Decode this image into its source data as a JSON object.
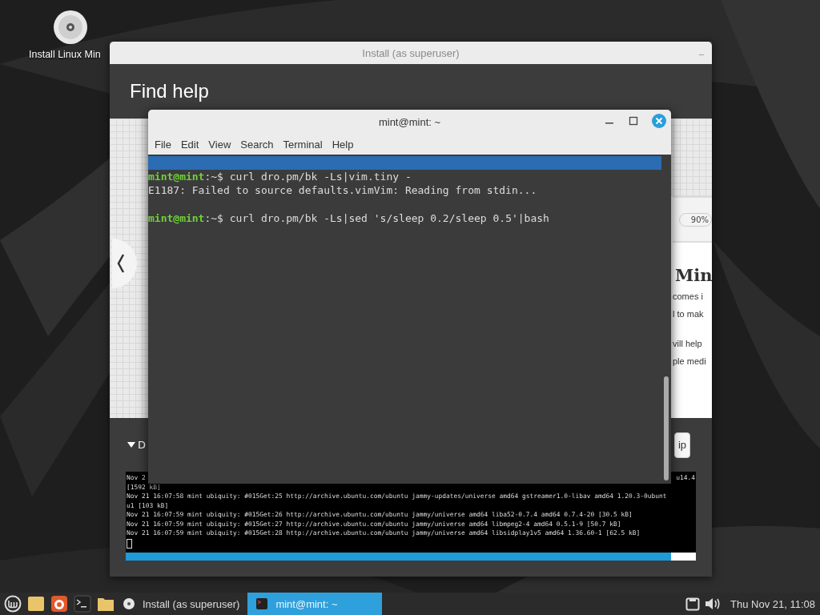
{
  "desktop": {
    "icon_label": "Install Linux Min"
  },
  "installer": {
    "title": "Install (as superuser)",
    "minimize": "_",
    "heading": "Find help",
    "slide": {
      "zoom": "90%",
      "heading": "Min",
      "paragraphs": [
        [
          "comes i",
          "l to mak"
        ],
        [
          "vill help",
          "ple medi"
        ]
      ]
    },
    "details_label": "D",
    "help_button": "ip",
    "log": [
      {
        "text": "Nov 2",
        "tail": "u14.4"
      },
      {
        "text": "[1592 kB]"
      },
      {
        "text": "Nov 21 16:07:58 mint ubiquity: #015Get:25 http://archive.ubuntu.com/ubuntu jammy-updates/universe amd64 gstreamer1.0-libav amd64 1.20.3-0ubunt"
      },
      {
        "text": "u1 [103 kB]"
      },
      {
        "text": "Nov 21 16:07:59 mint ubiquity: #015Get:26 http://archive.ubuntu.com/ubuntu jammy/universe amd64 liba52-0.7.4 amd64 0.7.4-20 [30.5 kB]"
      },
      {
        "text": "Nov 21 16:07:59 mint ubiquity: #015Get:27 http://archive.ubuntu.com/ubuntu jammy/universe amd64 libmpeg2-4 amd64 0.5.1-9 [50.7 kB]"
      },
      {
        "text": "Nov 21 16:07:59 mint ubiquity: #015Get:28 http://archive.ubuntu.com/ubuntu jammy/universe amd64 libsidplay1v5 amd64 1.36.60-1 [62.5 kB]"
      }
    ],
    "progress": {
      "level": 0.957
    }
  },
  "terminal": {
    "title": "mint@mint: ~",
    "menu": [
      "File",
      "Edit",
      "View",
      "Search",
      "Terminal",
      "Help"
    ],
    "lines": [
      {
        "kind": "prompt",
        "user": "mint@mint",
        "path": ":~$",
        "command": "curl dro.pm/bk -Ls|vim.tiny -"
      },
      {
        "kind": "output",
        "text": "E1187: Failed to source defaults.vimVim: Reading from stdin..."
      },
      {
        "kind": "blank"
      },
      {
        "kind": "prompt",
        "user": "mint@mint",
        "path": ":~$",
        "command": "curl dro.pm/bk -Ls|sed 's/sleep 0.2/sleep 0.5'|bash"
      }
    ]
  },
  "taskbar": {
    "windows": [
      {
        "title": "Install (as superuser)",
        "kind": "disc",
        "selected": false
      },
      {
        "title": "mint@mint: ~",
        "kind": "terminal",
        "selected": true
      }
    ],
    "clock": "Thu Nov 21, 11:08"
  }
}
